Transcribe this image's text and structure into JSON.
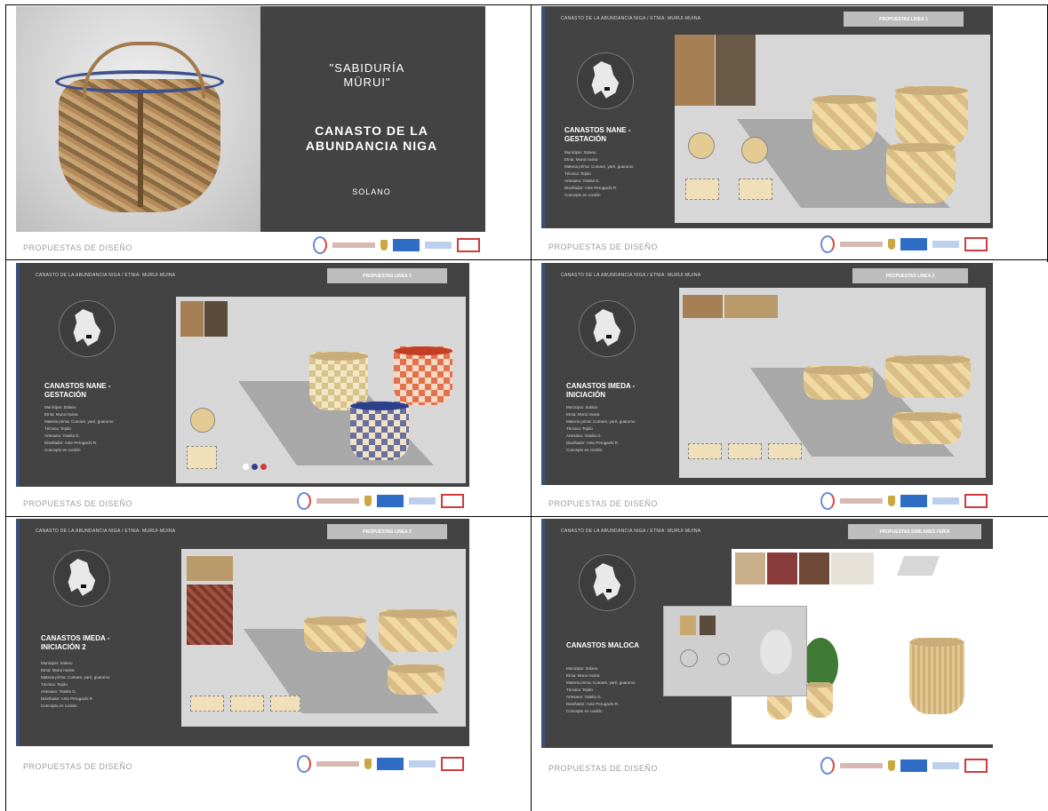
{
  "slide1": {
    "title1": "\"SABIDURÍA MÜRUI\"",
    "title2": "CANASTO DE LA ABUNDANCIA NIGA",
    "author": "SOLANO",
    "footer": "PROPUESTAS DE DISEÑO"
  },
  "slides": [
    {
      "header": "CANASTO DE LA ABUNDANCIA NIGA / ETNIA: MURUI-MUINA",
      "button": "PROPUESTAS LINEA 1",
      "section": "CANASTOS NANE - GESTACIÓN",
      "footer": "PROPUESTAS DE DISEÑO"
    },
    {
      "header": "CANASTO DE LA ABUNDANCIA NIGA / ETNIA: MURUI-MUINA",
      "button": "PROPUESTAS LINEA 1",
      "section": "CANASTOS NANE - GESTACIÓN",
      "footer": "PROPUESTAS DE DISEÑO"
    },
    {
      "header": "CANASTO DE LA ABUNDANCIA NIGA / ETNIA: MURUI-MUINA",
      "button": "PROPUESTAS LINEA 2",
      "section": "CANASTOS IMEDA - INICIACIÓN",
      "footer": "PROPUESTAS DE DISEÑO"
    },
    {
      "header": "CANASTO DE LA ABUNDANCIA NIGA / ETNIA: MURUI-MUINA",
      "button": "PROPUESTAS LINEA 2",
      "section": "CANASTOS IMEDA - INICIACIÓN 2",
      "footer": "PROPUESTAS DE DISEÑO"
    },
    {
      "header": "CANASTO DE LA ABUNDANCIA NIGA / ETNIA: MURUI-MUINA",
      "button": "PROPUESTAS SIMILARES FERIA",
      "section": "CANASTOS MALOCA",
      "footer": "PROPUESTAS DE DISEÑO"
    }
  ],
  "info_lines": [
    "Municipio: Solano",
    "Etnia: Murui muina",
    "Materia prima: Cumare, yaré, guarumo",
    "Técnica: Tejido",
    "Artesano: Yatelia G.",
    "Diseñador: Ante Perugachi R.",
    "Concepto en cordón"
  ]
}
